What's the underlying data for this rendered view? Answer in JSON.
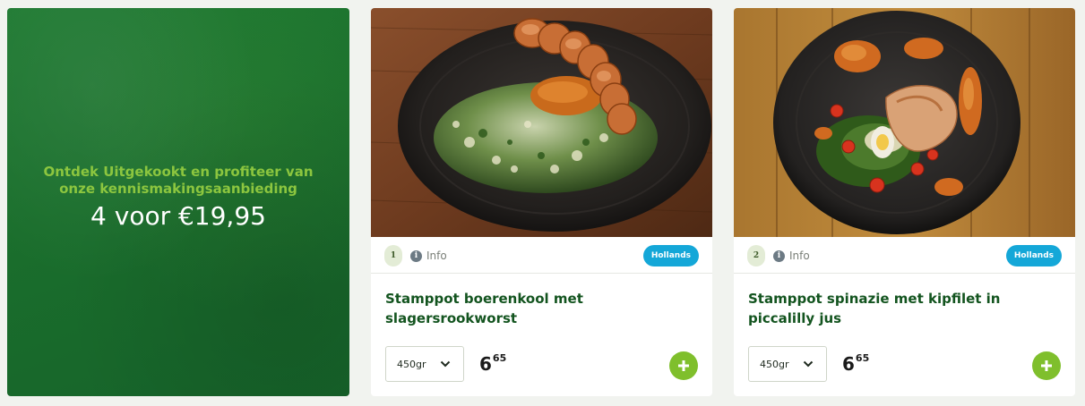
{
  "promo": {
    "subtitle": "Ontdek Uitgekookt en profiteer van onze kennismakingsaanbieding",
    "price_line": "4 voor €19,95",
    "colors": {
      "background": "#1b6f2e",
      "subtitle": "#8cc63f",
      "price": "#ffffff"
    }
  },
  "products": [
    {
      "number": "1",
      "info_label": "Info",
      "info_icon": "info-circle-icon",
      "cuisine": "Hollands",
      "title": "Stamppot boerenkool met slagersrookworst",
      "weight": "450gr",
      "price_int": "6",
      "price_dec": "65",
      "add_icon": "plus-icon"
    },
    {
      "number": "2",
      "info_label": "Info",
      "info_icon": "info-circle-icon",
      "cuisine": "Hollands",
      "title": "Stamppot spinazie met kipfilet in piccalilly jus",
      "weight": "450gr",
      "price_int": "6",
      "price_dec": "65",
      "add_icon": "plus-icon"
    }
  ],
  "colors": {
    "page_bg": "#f1f3ef",
    "title_green": "#13541f",
    "badge_blue": "#14a7d8",
    "add_green": "#7fbf2c"
  }
}
